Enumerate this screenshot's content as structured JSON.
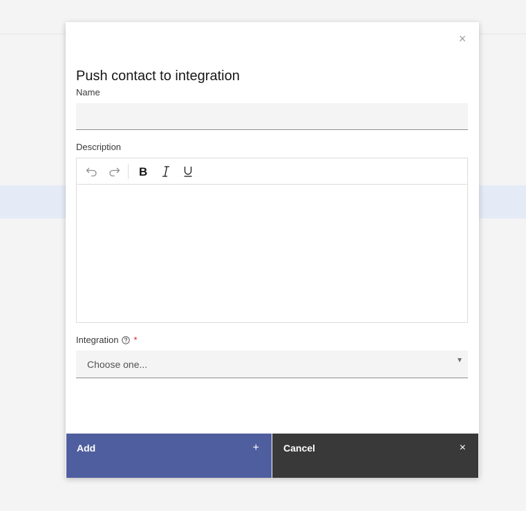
{
  "modal": {
    "title": "Push contact to integration",
    "close_icon": "close-icon",
    "name_label": "Name",
    "name_value": "",
    "description_label": "Description",
    "toolbar": [
      "undo-icon",
      "redo-icon",
      "bold-icon",
      "italic-icon",
      "underline-icon"
    ],
    "integration_label": "Integration",
    "required_mark": "*",
    "integration_select": {
      "selected": "Choose one..."
    },
    "buttons": {
      "add_label": "Add",
      "add_icon": "+",
      "cancel_label": "Cancel",
      "cancel_icon": "×"
    }
  },
  "colors": {
    "primary_button": "#4f5e9e",
    "secondary_button": "#393939",
    "required": "#da1e28",
    "highlight_band": "#e5ebf6"
  }
}
